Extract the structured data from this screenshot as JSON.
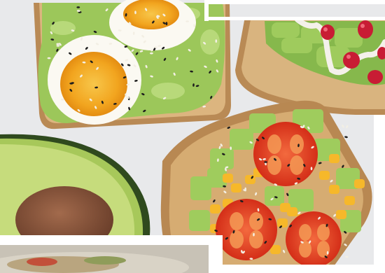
{
  "image": {
    "subject": "avocado-toast-flatlay",
    "colors": {
      "background": "#e9eaec",
      "bread_crust": "#b98a55",
      "bread_crumb": "#d9b47f",
      "avocado_mash": "#9cc75a",
      "avocado_skin": "#2f4a1e",
      "avocado_flesh": "#c6dc7c",
      "avocado_pit": "#7a4b33",
      "egg_white": "#fbf9f2",
      "egg_yolk": "#f2a51f",
      "tomato": "#e2361f",
      "corn": "#f6b82a",
      "pomegranate": "#c81c34",
      "yogurt_sauce": "#f4f1ea",
      "frame_white": "#ffffff"
    }
  }
}
